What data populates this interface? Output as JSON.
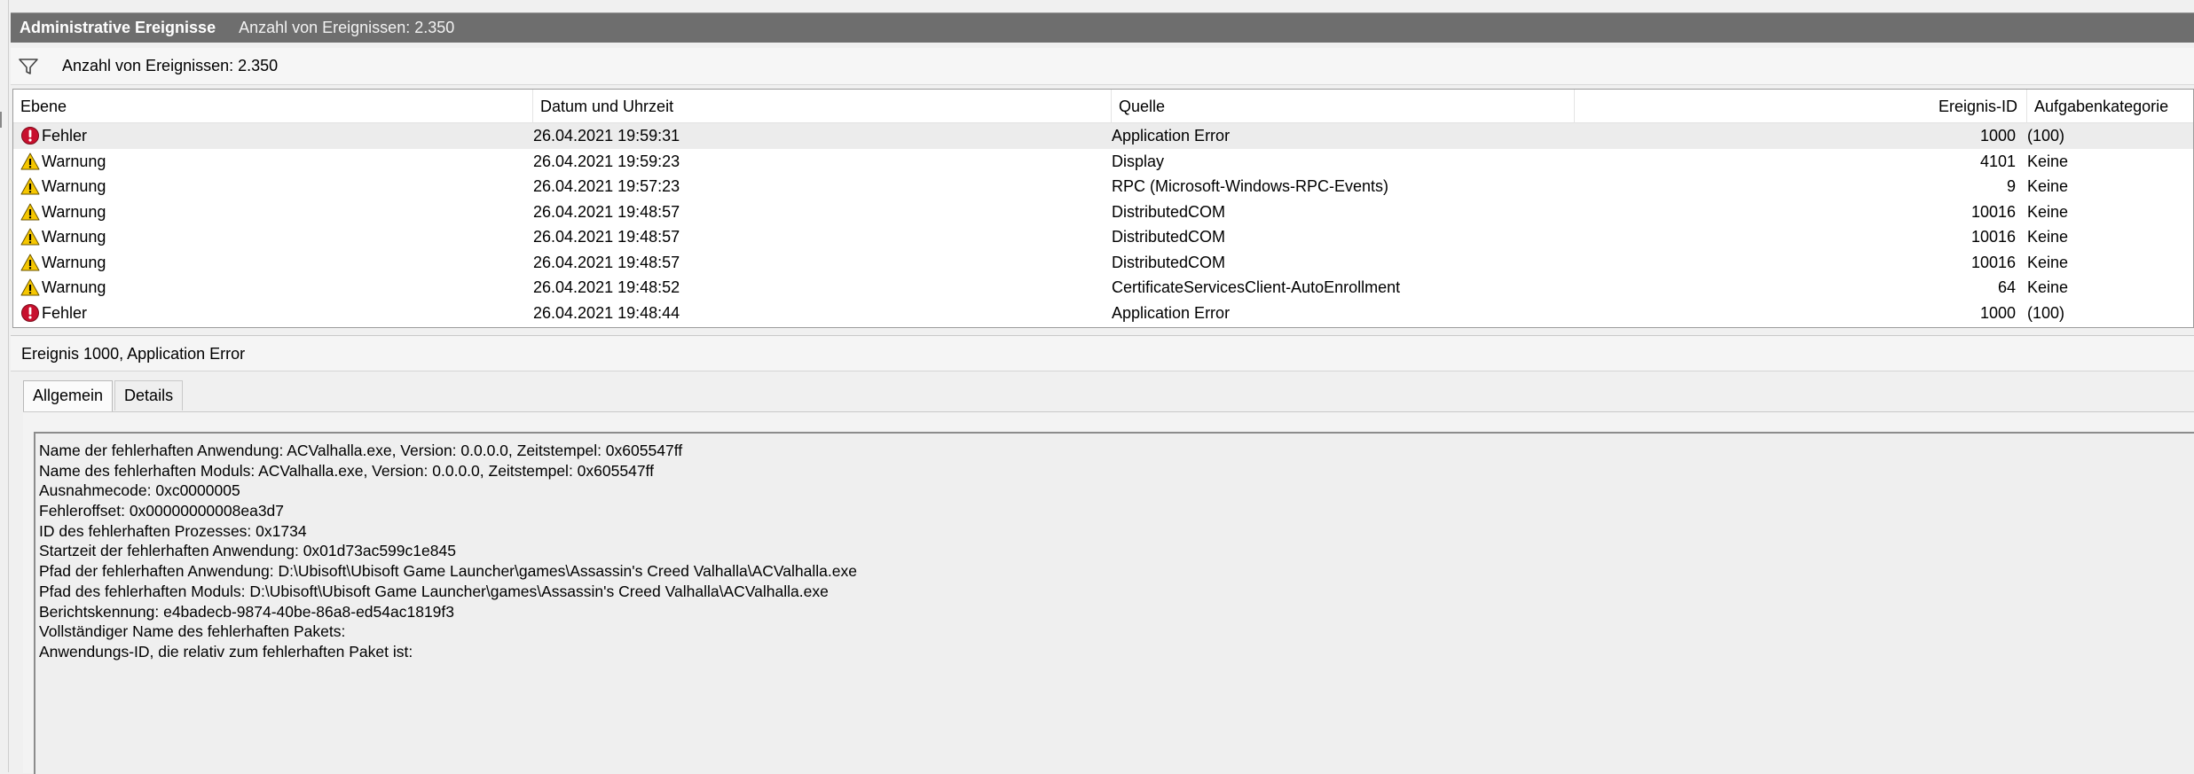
{
  "titlebar": {
    "title": "Administrative Ereignisse",
    "count": "Anzahl von Ereignissen: 2.350"
  },
  "filterbar": {
    "icon": "filter-icon",
    "text": "Anzahl von Ereignissen: 2.350"
  },
  "table": {
    "columns": {
      "level": "Ebene",
      "date": "Datum und Uhrzeit",
      "source": "Quelle",
      "event_id": "Ereignis-ID",
      "task": "Aufgabenkategorie"
    },
    "rows": [
      {
        "level": "Fehler",
        "icon": "error-icon",
        "date": "26.04.2021 19:59:31",
        "source": "Application Error",
        "event_id": "1000",
        "task": "(100)"
      },
      {
        "level": "Warnung",
        "icon": "warning-icon",
        "date": "26.04.2021 19:59:23",
        "source": "Display",
        "event_id": "4101",
        "task": "Keine"
      },
      {
        "level": "Warnung",
        "icon": "warning-icon",
        "date": "26.04.2021 19:57:23",
        "source": "RPC (Microsoft-Windows-RPC-Events)",
        "event_id": "9",
        "task": "Keine"
      },
      {
        "level": "Warnung",
        "icon": "warning-icon",
        "date": "26.04.2021 19:48:57",
        "source": "DistributedCOM",
        "event_id": "10016",
        "task": "Keine"
      },
      {
        "level": "Warnung",
        "icon": "warning-icon",
        "date": "26.04.2021 19:48:57",
        "source": "DistributedCOM",
        "event_id": "10016",
        "task": "Keine"
      },
      {
        "level": "Warnung",
        "icon": "warning-icon",
        "date": "26.04.2021 19:48:57",
        "source": "DistributedCOM",
        "event_id": "10016",
        "task": "Keine"
      },
      {
        "level": "Warnung",
        "icon": "warning-icon",
        "date": "26.04.2021 19:48:52",
        "source": "CertificateServicesClient-AutoEnrollment",
        "event_id": "64",
        "task": "Keine"
      },
      {
        "level": "Fehler",
        "icon": "error-icon",
        "date": "26.04.2021 19:48:44",
        "source": "Application Error",
        "event_id": "1000",
        "task": "(100)"
      }
    ]
  },
  "detail": {
    "header": "Ereignis 1000, Application Error",
    "tabs": [
      "Allgemein",
      "Details"
    ],
    "message_lines": [
      "Name der fehlerhaften Anwendung: ACValhalla.exe, Version: 0.0.0.0, Zeitstempel: 0x605547ff",
      "Name des fehlerhaften Moduls: ACValhalla.exe, Version: 0.0.0.0, Zeitstempel: 0x605547ff",
      "Ausnahmecode: 0xc0000005",
      "Fehleroffset: 0x00000000008ea3d7",
      "ID des fehlerhaften Prozesses: 0x1734",
      "Startzeit der fehlerhaften Anwendung: 0x01d73ac599c1e845",
      "Pfad der fehlerhaften Anwendung: D:\\Ubisoft\\Ubisoft Game Launcher\\games\\Assassin's Creed Valhalla\\ACValhalla.exe",
      "Pfad des fehlerhaften Moduls: D:\\Ubisoft\\Ubisoft Game Launcher\\games\\Assassin's Creed Valhalla\\ACValhalla.exe",
      "Berichtskennung: e4badecb-9874-40be-86a8-ed54ac1819f3",
      "Vollständiger Name des fehlerhaften Pakets:",
      "Anwendungs-ID, die relativ zum fehlerhaften Paket ist:"
    ]
  },
  "colors": {
    "titlebar_bg": "#6e6e6e",
    "selected_row": "#ececec",
    "error_red": "#c8102e",
    "warning_yellow": "#f6c700"
  }
}
